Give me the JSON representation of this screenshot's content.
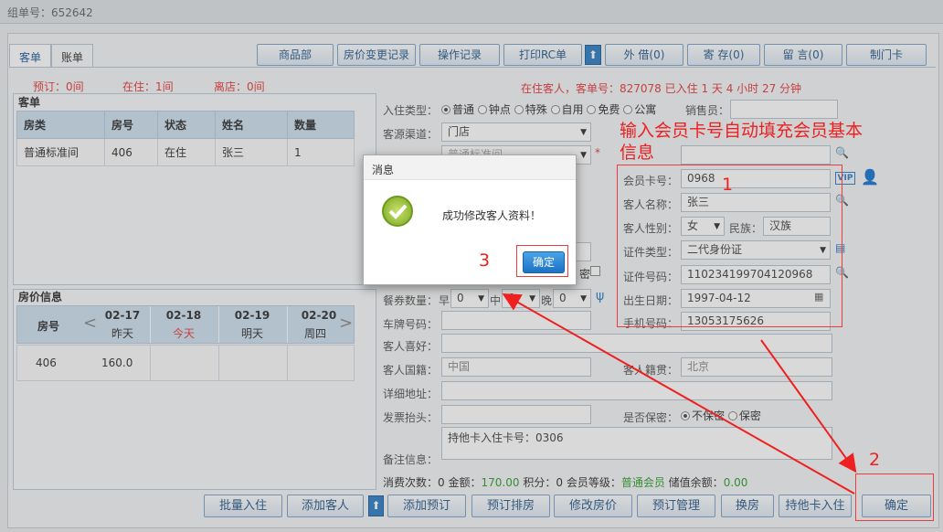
{
  "title": "组单号：652642",
  "tabs": [
    "客单",
    "账单"
  ],
  "toolbar": [
    "商品部",
    "房价变更记录",
    "操作记录",
    "打印RC单",
    "外 借(0)",
    "寄 存(0)",
    "留 言(0)",
    "制门卡"
  ],
  "status": {
    "reserved": "预订：0间",
    "in": "在住：1间",
    "left": "离店：0间",
    "guest_info": "在住客人，客单号：827078 已入住 1 天 4 小时 27 分钟"
  },
  "order": {
    "title": "客单",
    "headers": [
      "房类",
      "房号",
      "状态",
      "姓名",
      "数量"
    ],
    "rows": [
      [
        "普通标准间",
        "406",
        "在住",
        "张三",
        "1"
      ]
    ]
  },
  "rate": {
    "title": "房价信息",
    "room_header": "房号",
    "days": [
      {
        "date": "02-17",
        "label": "昨天"
      },
      {
        "date": "02-18",
        "label": "今天"
      },
      {
        "date": "02-19",
        "label": "明天"
      },
      {
        "date": "02-20",
        "label": "周四"
      }
    ],
    "rows": [
      [
        "406",
        "160.0",
        "",
        "",
        ""
      ]
    ]
  },
  "form": {
    "checkin_type_label": "入住类型：",
    "checkin_types": [
      "普通",
      "钟点",
      "特殊",
      "自用",
      "免费",
      "公寓"
    ],
    "source_label": "客源渠道：",
    "source": "门店",
    "room_type_partial": "普通标准间",
    "salesperson_label": "销售员：",
    "member_no_label": "会员卡号：",
    "member_no": "0968",
    "guest_name_label": "客人名称：",
    "guest_name": "张三",
    "gender_label": "客人性别：",
    "gender": "女",
    "nation_label": "民族：",
    "nation": "汉族",
    "id_type_label": "证件类型：",
    "id_type": "二代身份证",
    "id_no_label": "证件号码：",
    "id_no": "110234199704120968",
    "birth_label": "出生日期：",
    "birth": "1997-04-12",
    "phone_label": "手机号码：",
    "phone": "13053175626",
    "meal_label": "餐券数量：",
    "breakfast": "早",
    "breakfast_val": "0",
    "lunch": "中",
    "lunch_val": "0",
    "dinner": "晚",
    "dinner_val": "0",
    "plate_label": "车牌号码：",
    "hobby_label": "客人喜好：",
    "nationality_label": "客人国籍：",
    "nationality": "中国",
    "origin_label": "客人籍贯：",
    "origin": "北京",
    "address_label": "详细地址：",
    "invoice_label": "发票抬头：",
    "secret_label": "是否保密：",
    "secret_opts": [
      "不保密",
      "保密"
    ],
    "remark_label": "备注信息：",
    "remark": "持他卡入住卡号：0306",
    "secret_checkbox_label": "密"
  },
  "stats": {
    "consume_label": "消费次数：",
    "consume": "0",
    "amount_label": "金额：",
    "amount": "170.00",
    "points_label": "积分：",
    "points": "0",
    "level_label": "会员等级：",
    "level": "普通会员",
    "balance_label": "储值余额：",
    "balance": "0.00"
  },
  "bottom_buttons": [
    "批量入住",
    "添加客人",
    "添加预订",
    "预订排房",
    "修改房价",
    "预订管理",
    "换房",
    "持他卡入住",
    "确定"
  ],
  "dialog": {
    "title": "消息",
    "message": "成功修改客人资料！",
    "ok": "确定"
  },
  "annotations": {
    "note": "输入会员卡号自动填充会员基本信息",
    "n1": "1",
    "n2": "2",
    "n3": "3"
  },
  "colors": {
    "accent": "#2a5b8c",
    "red": "#e63b3b",
    "green": "#2e9e2e"
  }
}
